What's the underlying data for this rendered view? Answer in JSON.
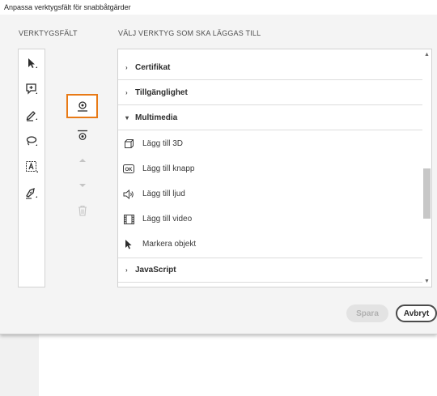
{
  "window": {
    "title": "Anpassa verktygsfält för snabbåtgärder"
  },
  "sections": {
    "toolbar_label": "VERKTYGSFÄLT",
    "choose_label": "VÄLJ VERKTYG SOM SKA LÄGGAS TILL"
  },
  "toolbar_icons": [
    "select-arrow-icon",
    "add-comment-icon",
    "pen-icon",
    "lasso-icon",
    "text-box-icon",
    "sign-pen-icon"
  ],
  "controls": {
    "add_icon": "add-to-toolbar-icon",
    "insert_separator_icon": "separator-icon",
    "move_up_icon": "move-up-icon",
    "move_down_icon": "move-down-icon",
    "delete_icon": "trash-icon"
  },
  "list": {
    "categories": [
      {
        "label": "Certifikat",
        "expanded": false
      },
      {
        "label": "Tillgänglighet",
        "expanded": false
      },
      {
        "label": "Multimedia",
        "expanded": true
      },
      {
        "label": "JavaScript",
        "expanded": false
      }
    ],
    "multimedia_tools": [
      {
        "label": "Lägg till 3D",
        "icon": "cube-icon"
      },
      {
        "label": "Lägg till knapp",
        "icon": "ok-button-icon"
      },
      {
        "label": "Lägg till ljud",
        "icon": "speaker-icon"
      },
      {
        "label": "Lägg till video",
        "icon": "film-icon"
      },
      {
        "label": "Markera objekt",
        "icon": "pointer-icon"
      }
    ]
  },
  "buttons": {
    "save": "Spara",
    "cancel": "Avbryt"
  },
  "colors": {
    "selection_border": "#e87a16",
    "dialog_bg": "#f4f4f4"
  }
}
